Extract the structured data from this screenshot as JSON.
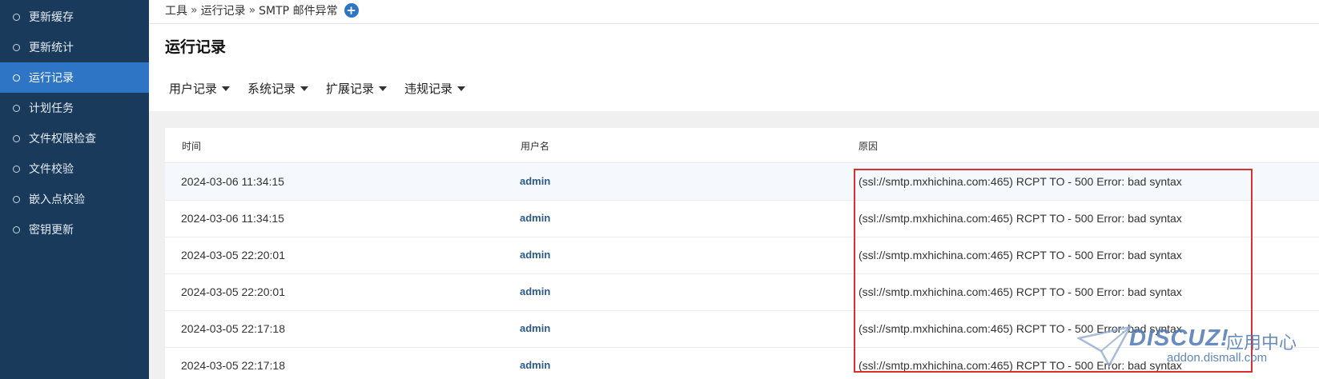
{
  "sidebar": {
    "items": [
      {
        "label": "更新缓存",
        "active": false
      },
      {
        "label": "更新统计",
        "active": false
      },
      {
        "label": "运行记录",
        "active": true
      },
      {
        "label": "计划任务",
        "active": false
      },
      {
        "label": "文件权限检查",
        "active": false
      },
      {
        "label": "文件校验",
        "active": false
      },
      {
        "label": "嵌入点校验",
        "active": false
      },
      {
        "label": "密钥更新",
        "active": false
      }
    ]
  },
  "breadcrumb": {
    "items": [
      "工具",
      "运行记录",
      "SMTP 邮件异常"
    ],
    "separator": "»",
    "add_icon": "plus-icon"
  },
  "page": {
    "title": "运行记录"
  },
  "tabs": [
    {
      "label": "用户记录"
    },
    {
      "label": "系统记录"
    },
    {
      "label": "扩展记录"
    },
    {
      "label": "违规记录"
    }
  ],
  "table": {
    "headers": {
      "time": "时间",
      "user": "用户名",
      "reason": "原因"
    },
    "rows": [
      {
        "time": "2024-03-06 11:34:15",
        "user": "admin",
        "reason": "(ssl://smtp.mxhichina.com:465) RCPT TO - 500 Error: bad syntax"
      },
      {
        "time": "2024-03-06 11:34:15",
        "user": "admin",
        "reason": "(ssl://smtp.mxhichina.com:465) RCPT TO - 500 Error: bad syntax"
      },
      {
        "time": "2024-03-05 22:20:01",
        "user": "admin",
        "reason": "(ssl://smtp.mxhichina.com:465) RCPT TO - 500 Error: bad syntax"
      },
      {
        "time": "2024-03-05 22:20:01",
        "user": "admin",
        "reason": "(ssl://smtp.mxhichina.com:465) RCPT TO - 500 Error: bad syntax"
      },
      {
        "time": "2024-03-05 22:17:18",
        "user": "admin",
        "reason": "(ssl://smtp.mxhichina.com:465) RCPT TO - 500 Error: bad syntax"
      },
      {
        "time": "2024-03-05 22:17:18",
        "user": "admin",
        "reason": "(ssl://smtp.mxhichina.com:465) RCPT TO - 500 Error: bad syntax"
      }
    ]
  },
  "watermark": {
    "brand": "DISCUZ!",
    "brand_cn": "应用中心",
    "url": "addon.dismall.com"
  },
  "colors": {
    "sidebar_bg": "#1a3a5c",
    "sidebar_active": "#2f75c6",
    "highlight_box": "#d9302c",
    "username": "#2a5a8a"
  }
}
